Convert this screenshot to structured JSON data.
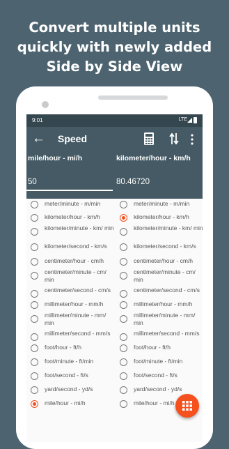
{
  "promo": {
    "lines": [
      "Convert multiple units",
      "quickly with newly added",
      "Side by Side View"
    ]
  },
  "status": {
    "time": "9:01",
    "network": "LTE"
  },
  "toolbar": {
    "title": "Speed",
    "back_icon": "arrow-left-icon",
    "calculator_icon": "calculator-icon",
    "swap_icon": "swap-vertical-icon",
    "more_icon": "more-vertical-icon"
  },
  "left": {
    "unit": "mile/hour - mi/h",
    "value": "50"
  },
  "right": {
    "unit": "kilometer/hour - km/h",
    "value": "80.46720"
  },
  "units": [
    "meter/minute - m/min",
    "kilometer/hour - km/h",
    "kilometer/minute - km/ min",
    "kilometer/second - km/s",
    "centimeter/hour - cm/h",
    "centimeter/minute - cm/ min",
    "centimeter/second - cm/s",
    "millimeter/hour - mm/h",
    "millimeter/minute - mm/ min",
    "millimeter/second - mm/s",
    "foot/hour - ft/h",
    "foot/minute - ft/min",
    "foot/second - ft/s",
    "yard/second - yd/s",
    "mile/hour - mi/h"
  ],
  "left_selected": "mile/hour - mi/h",
  "right_selected": "kilometer/hour - km/h",
  "colors": {
    "primary": "#455a64",
    "accent": "#f4511e",
    "background": "#4d6470"
  },
  "fab_icon": "grid-icon"
}
